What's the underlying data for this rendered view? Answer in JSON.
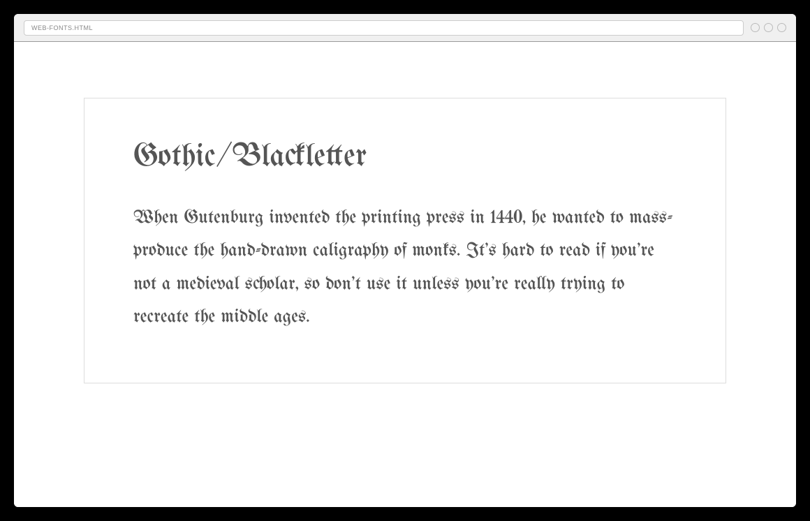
{
  "browser": {
    "url": "WEB-FONTS.HTML"
  },
  "content": {
    "heading": "Gothic/Blackletter",
    "body": "When Gutenburg invented the printing press in 1440, he wanted to mass-produce the hand-drawn caligraphy of monks. It's hard to read if you're not a medieval scholar, so don't use it unless you're really trying to recreate the middle ages."
  }
}
